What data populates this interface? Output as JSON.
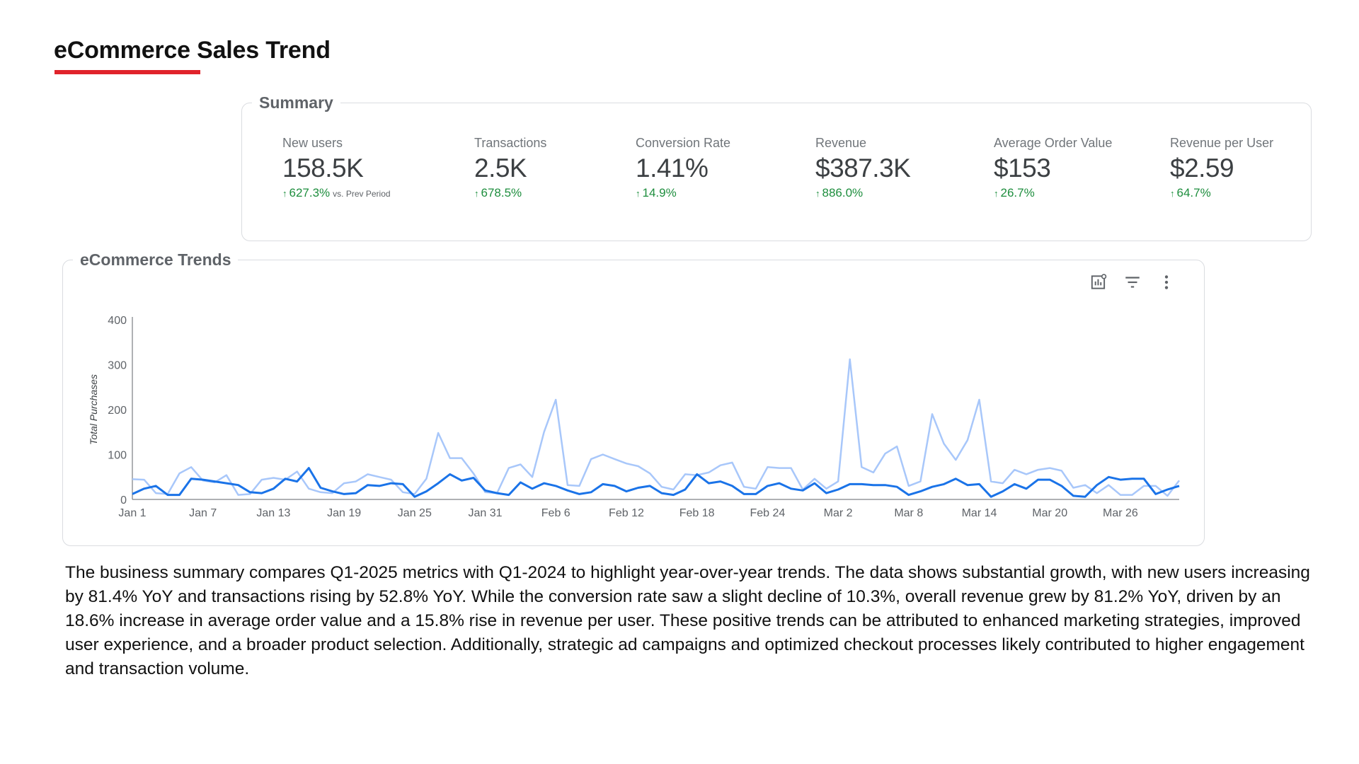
{
  "page": {
    "title": "eCommerce Sales Trend",
    "accent_color": "#e0232b"
  },
  "summary": {
    "legend": "Summary",
    "comparison_label": "vs. Prev Period",
    "metrics": [
      {
        "label": "New users",
        "value": "158.5K",
        "change": "627.3%"
      },
      {
        "label": "Transactions",
        "value": "2.5K",
        "change": "678.5%"
      },
      {
        "label": "Conversion Rate",
        "value": "1.41%",
        "change": "14.9%"
      },
      {
        "label": "Revenue",
        "value": "$387.3K",
        "change": "886.0%"
      },
      {
        "label": "Average Order Value",
        "value": "$153",
        "change": "26.7%"
      },
      {
        "label": "Revenue per User",
        "value": "$2.59",
        "change": "64.7%"
      }
    ],
    "change_color": "#1e8e3e"
  },
  "trends": {
    "legend": "eCommerce Trends",
    "icons": [
      "chart-customize-icon",
      "filter-icon",
      "more-vert-icon"
    ]
  },
  "chart_data": {
    "type": "line",
    "title": "",
    "xlabel": "",
    "ylabel": "Total Purchases",
    "ylim": [
      0,
      400
    ],
    "yticks": [
      0,
      100,
      200,
      300,
      400
    ],
    "x_start": "Jan 1",
    "x_ticks": [
      {
        "index": 0,
        "label": "Jan 1"
      },
      {
        "index": 6,
        "label": "Jan 7"
      },
      {
        "index": 12,
        "label": "Jan 13"
      },
      {
        "index": 18,
        "label": "Jan 19"
      },
      {
        "index": 24,
        "label": "Jan 25"
      },
      {
        "index": 30,
        "label": "Jan 31"
      },
      {
        "index": 36,
        "label": "Feb 6"
      },
      {
        "index": 42,
        "label": "Feb 12"
      },
      {
        "index": 48,
        "label": "Feb 18"
      },
      {
        "index": 54,
        "label": "Feb 24"
      },
      {
        "index": 60,
        "label": "Mar 2"
      },
      {
        "index": 66,
        "label": "Mar 8"
      },
      {
        "index": 72,
        "label": "Mar 14"
      },
      {
        "index": 78,
        "label": "Mar 20"
      },
      {
        "index": 84,
        "label": "Mar 26"
      }
    ],
    "x_count": 90,
    "grid": false,
    "series": [
      {
        "color": "#a8c7fa",
        "values": [
          45,
          44,
          14,
          12,
          58,
          72,
          42,
          38,
          54,
          10,
          12,
          44,
          48,
          44,
          62,
          24,
          16,
          14,
          36,
          40,
          56,
          50,
          44,
          16,
          12,
          46,
          148,
          92,
          92,
          58,
          16,
          14,
          70,
          78,
          50,
          150,
          222,
          32,
          30,
          90,
          100,
          90,
          80,
          74,
          58,
          28,
          22,
          56,
          54,
          60,
          76,
          82,
          28,
          24,
          72,
          70,
          70,
          22,
          46,
          24,
          40,
          312,
          72,
          60,
          102,
          118,
          30,
          40,
          190,
          124,
          88,
          132,
          222,
          40,
          36,
          66,
          56,
          66,
          70,
          64,
          26,
          32,
          14,
          32,
          10,
          10,
          30,
          30,
          8,
          42,
          12
        ]
      },
      {
        "color": "#1a73e8",
        "values": [
          12,
          24,
          30,
          10,
          10,
          46,
          44,
          40,
          36,
          32,
          16,
          14,
          24,
          46,
          40,
          70,
          26,
          18,
          12,
          14,
          32,
          30,
          36,
          34,
          6,
          18,
          36,
          56,
          42,
          48,
          20,
          14,
          10,
          38,
          24,
          36,
          30,
          20,
          12,
          16,
          34,
          30,
          18,
          26,
          30,
          14,
          10,
          22,
          56,
          36,
          40,
          30,
          12,
          12,
          30,
          36,
          24,
          20,
          36,
          14,
          22,
          34,
          34,
          32,
          32,
          28,
          10,
          18,
          28,
          34,
          46,
          32,
          34,
          6,
          18,
          34,
          24,
          44,
          44,
          30,
          8,
          6,
          32,
          50,
          44,
          46,
          46,
          12,
          22,
          30,
          28
        ]
      }
    ]
  },
  "description": "The business summary compares Q1-2025 metrics with Q1-2024 to highlight year-over-year trends. The data shows substantial growth, with new users increasing by 81.4% YoY and transactions rising by 52.8% YoY. While the conversion rate saw a slight decline of 10.3%, overall revenue grew by 81.2% YoY, driven by an 18.6% increase in average order value and a 15.8% rise in revenue per user. These positive trends can be attributed to enhanced marketing strategies, improved user experience, and a broader product selection. Additionally, strategic ad campaigns and optimized checkout processes likely contributed to higher engagement and transaction volume."
}
